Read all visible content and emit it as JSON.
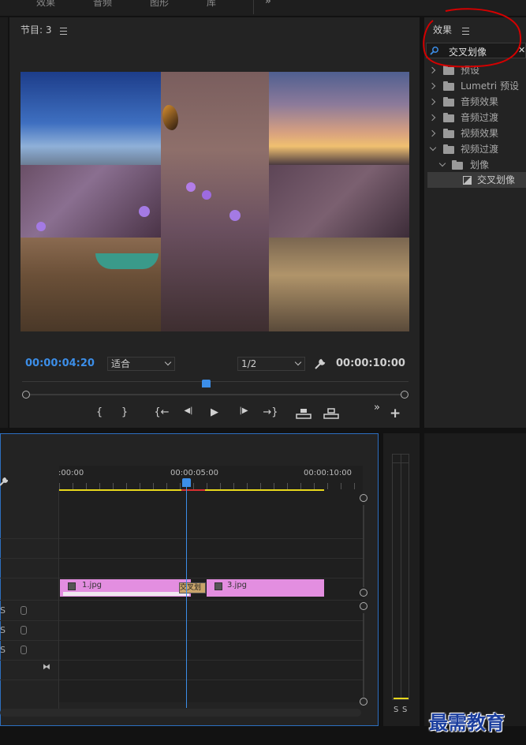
{
  "top_tabs": {
    "effects": "效果",
    "audio": "音频",
    "graphics": "图形",
    "library": "库",
    "overflow": "»"
  },
  "monitor": {
    "title": "节目: 3",
    "current_time": "00:00:04:20",
    "fit_label": "适合",
    "resolution": "1/2",
    "duration": "00:00:10:00",
    "playhead_fraction": 0.475,
    "controls": {
      "mark_in": "{",
      "mark_out": "}",
      "goto_in": "{←",
      "step_back": "◀|",
      "play": "▶",
      "step_forward": "|▶",
      "goto_out": "→}",
      "overflow": "»",
      "add": "+"
    }
  },
  "effects_panel": {
    "title": "效果",
    "search_value": "交叉划像",
    "clear": "✕",
    "tree": [
      {
        "label": "预设",
        "expanded": false,
        "indent": 0
      },
      {
        "label": "Lumetri 预设",
        "expanded": false,
        "indent": 0
      },
      {
        "label": "音频效果",
        "expanded": false,
        "indent": 0
      },
      {
        "label": "音频过渡",
        "expanded": false,
        "indent": 0
      },
      {
        "label": "视频效果",
        "expanded": false,
        "indent": 0
      },
      {
        "label": "视频过渡",
        "expanded": true,
        "indent": 0
      },
      {
        "label": "划像",
        "expanded": true,
        "indent": 1
      },
      {
        "label": "交叉划像",
        "indent": 2,
        "selected": true
      }
    ]
  },
  "timeline": {
    "ruler": {
      "start": ":00:00",
      "mid": "00:00:05:00",
      "end": "00:00:10:00"
    },
    "audio_tracks": [
      {
        "label": "S"
      },
      {
        "label": "S"
      },
      {
        "label": "S"
      }
    ],
    "clips": [
      {
        "label": "1.jpg"
      },
      {
        "label": "3.jpg"
      }
    ],
    "transition_label": "交叉划"
  },
  "audio_meter": {
    "left": "S",
    "right": "S"
  },
  "watermark": "最需教育",
  "colors": {
    "accent_blue": "#3c8ee8",
    "clip_pink": "#e38ee0",
    "work_area_yellow": "#e8d81c",
    "annotation_red": "#d40000"
  }
}
